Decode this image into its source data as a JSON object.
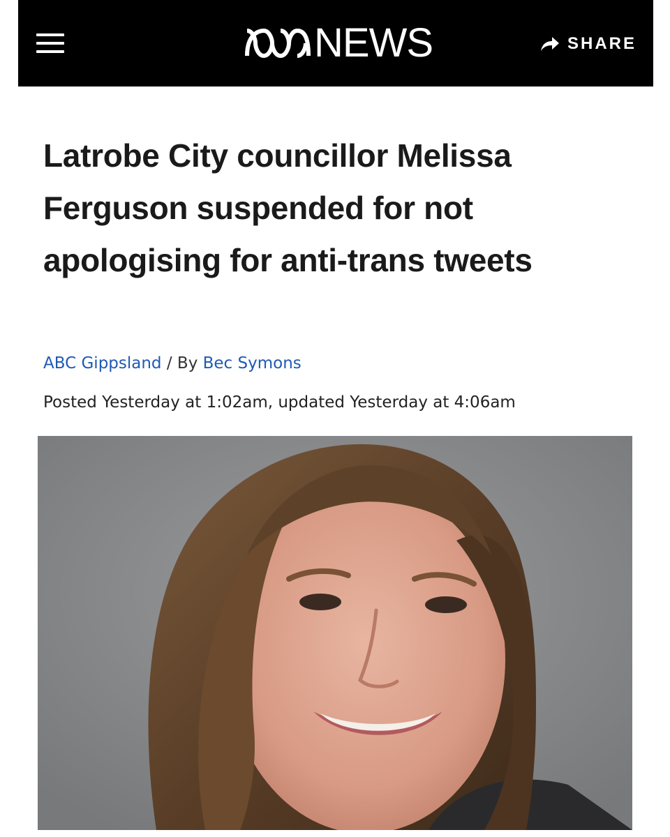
{
  "header": {
    "brand_text": "NEWS",
    "share_label": "SHARE",
    "icons": [
      "menu-icon",
      "abc-logo-icon",
      "share-arrow-icon"
    ]
  },
  "article": {
    "headline": "Latrobe City councillor Melissa Ferguson suspended for not apologising for anti-trans tweets",
    "byline": {
      "source": "ABC Gippsland",
      "separator": "/ By",
      "author": "Bec Symons"
    },
    "posted": "Posted Yesterday at 1:02am, updated Yesterday at 4:06am"
  },
  "colors": {
    "header_bg": "#000000",
    "link": "#1f5ab5",
    "photo_bg": "#8a8b8d"
  }
}
